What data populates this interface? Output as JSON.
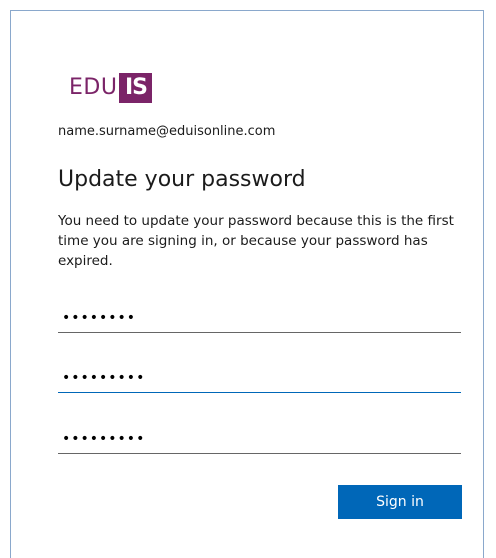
{
  "brand": {
    "logo_text": "EDU",
    "logo_badge": "IS",
    "color": "#7b2468"
  },
  "account": {
    "email": "name.surname@eduisonline.com"
  },
  "main": {
    "title": "Update your password",
    "description": "You need to update your password because this is the first time you are signing in, or because your password has expired."
  },
  "form": {
    "fields": [
      {
        "value": "pw123456",
        "state": "default"
      },
      {
        "value": "pw1234567",
        "state": "focused"
      },
      {
        "value": "pw1234567",
        "state": "default"
      }
    ],
    "submit_label": "Sign in",
    "accent": "#0067b8"
  }
}
